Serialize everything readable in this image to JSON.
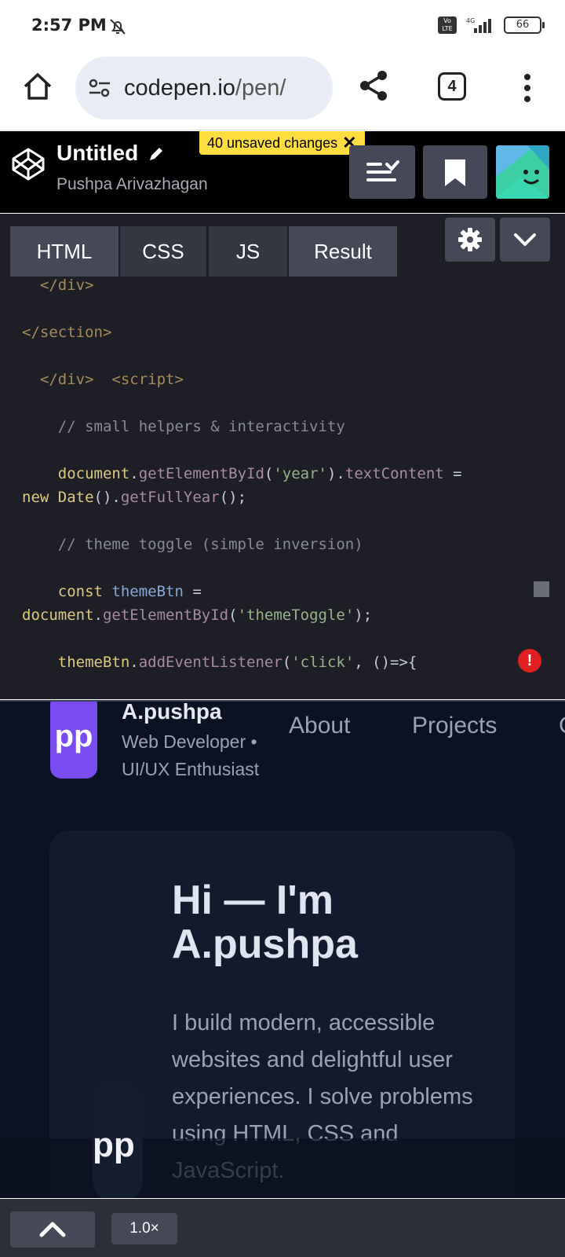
{
  "status_bar": {
    "time": "2:57 PM",
    "network": "4G",
    "volte": "Vo LTE",
    "battery": "66"
  },
  "browser": {
    "url_domain": "codepen.io",
    "url_path": "/pen/",
    "tab_count": "4"
  },
  "codepen": {
    "title": "Untitled",
    "author": "Pushpa Arivazhagan",
    "unsaved_badge": "40 unsaved changes"
  },
  "editor": {
    "tabs": [
      "HTML",
      "CSS",
      "JS",
      "Result"
    ],
    "code_lines": [
      [
        {
          "t": "  </div>",
          "c": "tag"
        }
      ],
      [],
      [
        {
          "t": "</section>",
          "c": "tag"
        }
      ],
      [],
      [
        {
          "t": "  </div>  ",
          "c": "tag"
        },
        {
          "t": "<script>",
          "c": "tag"
        }
      ],
      [],
      [
        {
          "t": "    // small helpers & interactivity",
          "c": "comment"
        }
      ],
      [],
      [
        {
          "t": "    document",
          "c": "ident"
        },
        {
          "t": ".",
          "c": "punc"
        },
        {
          "t": "getElementById",
          "c": "prop"
        },
        {
          "t": "(",
          "c": "punc"
        },
        {
          "t": "'year'",
          "c": "str"
        },
        {
          "t": ").",
          "c": "punc"
        },
        {
          "t": "textContent",
          "c": "prop"
        },
        {
          "t": " =",
          "c": "punc"
        }
      ],
      [
        {
          "t": "new ",
          "c": "kw"
        },
        {
          "t": "Date",
          "c": "ident"
        },
        {
          "t": "().",
          "c": "punc"
        },
        {
          "t": "getFullYear",
          "c": "prop"
        },
        {
          "t": "();",
          "c": "punc"
        }
      ],
      [],
      [
        {
          "t": "    // theme toggle (simple inversion)",
          "c": "comment"
        }
      ],
      [],
      [
        {
          "t": "    const ",
          "c": "kw"
        },
        {
          "t": "themeBtn",
          "c": "var"
        },
        {
          "t": " =",
          "c": "punc"
        }
      ],
      [
        {
          "t": "document",
          "c": "ident"
        },
        {
          "t": ".",
          "c": "punc"
        },
        {
          "t": "getElementById",
          "c": "prop"
        },
        {
          "t": "(",
          "c": "punc"
        },
        {
          "t": "'themeToggle'",
          "c": "str"
        },
        {
          "t": ");",
          "c": "punc"
        }
      ],
      [],
      [
        {
          "t": "    themeBtn",
          "c": "ident"
        },
        {
          "t": ".",
          "c": "punc"
        },
        {
          "t": "addEventListener",
          "c": "prop"
        },
        {
          "t": "(",
          "c": "punc"
        },
        {
          "t": "'click'",
          "c": "str"
        },
        {
          "t": ", ()=>{",
          "c": "punc"
        }
      ]
    ],
    "error_marker": "!"
  },
  "preview": {
    "logo": "pp",
    "name": "A.pushpa",
    "role_line1": "Web Developer •",
    "role_line2": "UI/UX Enthusiast",
    "nav_about": "About",
    "nav_projects": "Projects",
    "nav_partial": "C",
    "heading_line1": "Hi — I'm",
    "heading_line2": "A.pushpa",
    "intro": "I build modern, accessible websites and delightful user experiences. I solve problems using HTML, CSS and JavaScript.",
    "avatar_text": "pp"
  },
  "bottom_bar": {
    "zoom": "1.0×"
  },
  "colors": {
    "cp_black": "#000000",
    "editor_bg": "#1e1f26",
    "badge_yellow": "#ffdd40",
    "preview_bg": "#0b1224",
    "logo_purple": "#7a4bf0",
    "error_red": "#e02020"
  }
}
